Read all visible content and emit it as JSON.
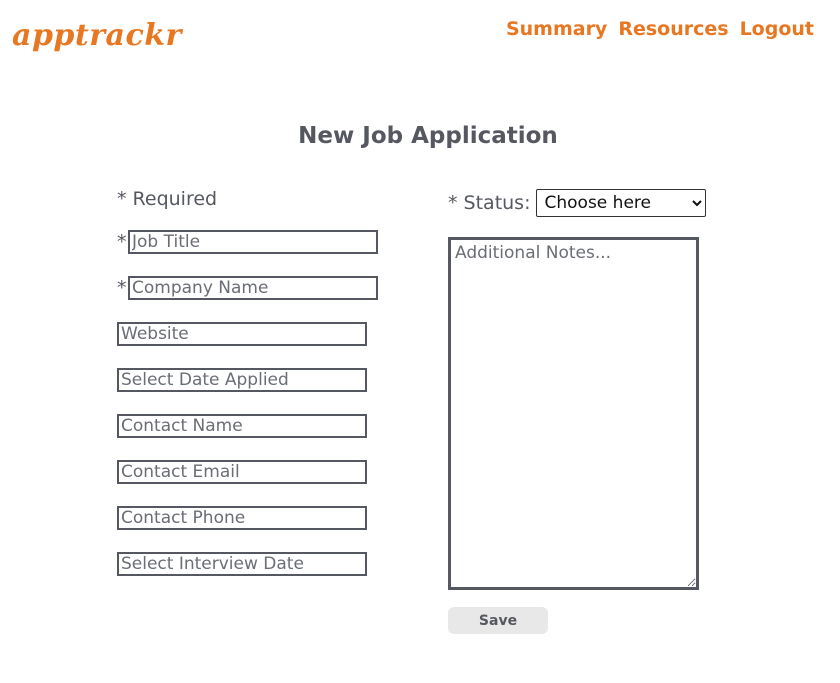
{
  "header": {
    "logo": "apptrackr",
    "nav": [
      "Summary",
      "Resources",
      "Logout"
    ]
  },
  "page": {
    "title": "New Job Application",
    "required_note": "* Required",
    "required_marker": "*"
  },
  "form": {
    "fields": {
      "job_title": {
        "placeholder": "Job Title",
        "required": true
      },
      "company_name": {
        "placeholder": "Company Name",
        "required": true
      },
      "website": {
        "placeholder": "Website",
        "required": false
      },
      "date_applied": {
        "placeholder": "Select Date Applied",
        "required": false
      },
      "contact_name": {
        "placeholder": "Contact Name",
        "required": false
      },
      "contact_email": {
        "placeholder": "Contact Email",
        "required": false
      },
      "contact_phone": {
        "placeholder": "Contact Phone",
        "required": false
      },
      "interview_date": {
        "placeholder": "Select Interview Date",
        "required": false
      }
    },
    "status": {
      "label": "* Status:",
      "selected": "Choose here"
    },
    "notes": {
      "placeholder": "Additional Notes..."
    },
    "save_label": "Save"
  },
  "colors": {
    "accent": "#e87722",
    "text": "#555860",
    "border": "#555860",
    "button_bg": "#e8e8e8"
  }
}
